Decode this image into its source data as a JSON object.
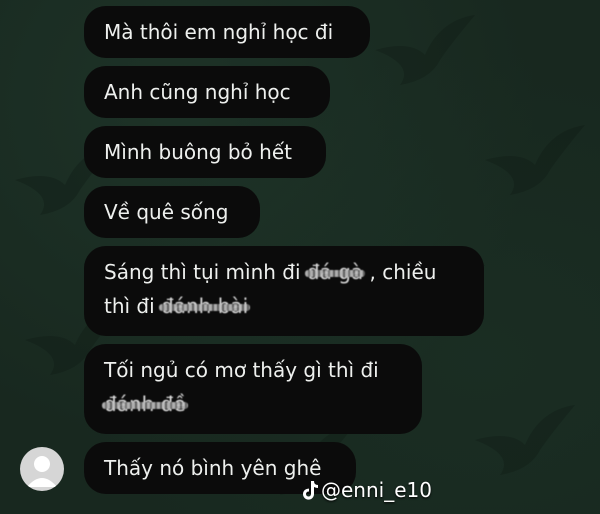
{
  "chat": {
    "messages": [
      {
        "text": "Mà thôi em nghỉ học đi"
      },
      {
        "text": "Anh cũng nghỉ học"
      },
      {
        "text": "Mình buông bỏ hết"
      },
      {
        "text": "Về quê sống"
      },
      {
        "line1_pre": "Sáng thì tụi mình đi ",
        "line1_struck": "đá gà",
        "line1_post": " , chiều",
        "line2_pre": "thì đi ",
        "line2_struck": "đánh bài"
      },
      {
        "line1": "Tối ngủ có mơ thấy gì thì đi",
        "line2_struck": "đánh đề"
      },
      {
        "text": "Thấy nó bình yên ghê"
      }
    ]
  },
  "watermark": {
    "handle": "@enni_e10",
    "icon": "tiktok-icon"
  },
  "colors": {
    "background": "#18281f",
    "bubble": "#0b0b0b",
    "text": "#eef0ee"
  }
}
